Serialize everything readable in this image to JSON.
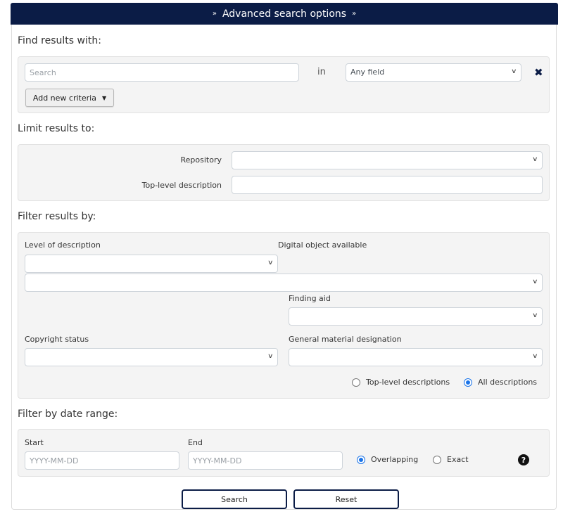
{
  "header": {
    "title": "Advanced search options",
    "left_icon": "double-chevron-down-icon",
    "right_icon": "double-chevron-down-icon"
  },
  "find": {
    "title": "Find results with:",
    "search_placeholder": "Search",
    "search_value": "",
    "in_label": "in",
    "field_select": "Any field",
    "remove_icon": "close-x-icon",
    "add_criteria_label": "Add new criteria"
  },
  "limit": {
    "title": "Limit results to:",
    "repository_label": "Repository",
    "repository_value": "",
    "top_level_label": "Top-level description",
    "top_level_value": ""
  },
  "filter": {
    "title": "Filter results by:",
    "level_label": "Level of description",
    "level_value": "",
    "digital_object_label": "Digital object available",
    "digital_object_value": "",
    "finding_aid_label": "Finding aid",
    "finding_aid_value": "",
    "copyright_label": "Copyright status",
    "copyright_value": "",
    "gmd_label": "General material designation",
    "gmd_value": "",
    "radio_options": [
      {
        "label": "Top-level descriptions",
        "checked": false
      },
      {
        "label": "All descriptions",
        "checked": true
      }
    ]
  },
  "date": {
    "title": "Filter by date range:",
    "start_label": "Start",
    "start_placeholder": "YYYY-MM-DD",
    "end_label": "End",
    "end_placeholder": "YYYY-MM-DD",
    "radio_options": [
      {
        "label": "Overlapping",
        "checked": true
      },
      {
        "label": "Exact",
        "checked": false
      }
    ],
    "help_icon": "question-circle-icon"
  },
  "actions": {
    "search_label": "Search",
    "reset_label": "Reset"
  },
  "colors": {
    "header_bg": "#0b1c46",
    "radio_accent": "#1a73e8",
    "button_border": "#0b1c46"
  }
}
